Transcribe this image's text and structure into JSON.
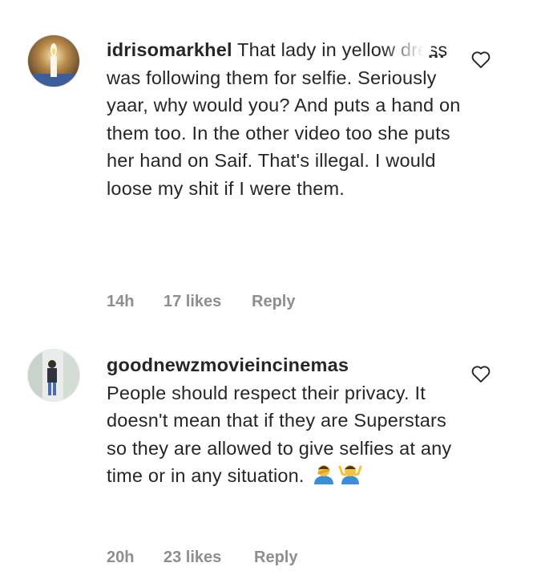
{
  "comments": [
    {
      "username": "idrisomarkhel",
      "text": "That lady in yellow dress was following them for selfie. Seriously yaar, why would you? And puts a hand on them too. In the other video too she puts her hand on Saif. That's illegal. I would loose my shit if I were them.",
      "more_label": "...",
      "time": "14h",
      "likes": "17 likes",
      "reply_label": "Reply",
      "avatar_icon": "candle-icon"
    },
    {
      "username": "goodnewzmovieincinemas",
      "text": "People should respect their privacy. It doesn't mean that if they are Superstars so they are allowed to give selfies at any time or in any situation.",
      "emojis": [
        "person-facepalming-emoji",
        "person-shrugging-emoji"
      ],
      "time": "20h",
      "likes": "23 likes",
      "reply_label": "Reply",
      "avatar_icon": "person-photo-icon"
    }
  ],
  "colors": {
    "text": "#262626",
    "meta": "#8e8e8e",
    "emoji_blue": "#3b8fd9",
    "emoji_skin": "#f5c33b"
  }
}
